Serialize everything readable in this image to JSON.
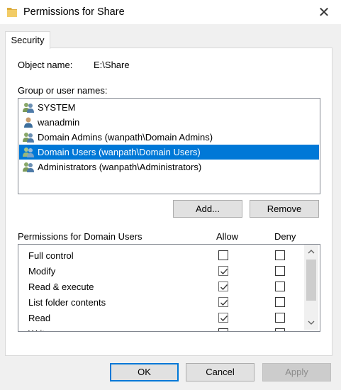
{
  "window": {
    "title": "Permissions for Share",
    "close_glyph": "✕"
  },
  "tabs": [
    {
      "label": "Security",
      "active": true
    }
  ],
  "object": {
    "label": "Object name:",
    "value": "E:\\Share"
  },
  "groups": {
    "label": "Group or user names:",
    "items": [
      {
        "name": "SYSTEM",
        "icon": "group-icon",
        "selected": false
      },
      {
        "name": "wanadmin",
        "icon": "user-icon",
        "selected": false
      },
      {
        "name": "Domain Admins (wanpath\\Domain Admins)",
        "icon": "group-icon",
        "selected": false
      },
      {
        "name": "Domain Users (wanpath\\Domain Users)",
        "icon": "group-icon",
        "selected": true
      },
      {
        "name": "Administrators (wanpath\\Administrators)",
        "icon": "group-icon",
        "selected": false
      }
    ]
  },
  "buttons": {
    "add": "Add...",
    "remove": "Remove",
    "ok": "OK",
    "cancel": "Cancel",
    "apply": "Apply"
  },
  "permissions": {
    "label": "Permissions for Domain Users",
    "allow_header": "Allow",
    "deny_header": "Deny",
    "rows": [
      {
        "name": "Full control",
        "allow": false,
        "deny": false
      },
      {
        "name": "Modify",
        "allow": true,
        "deny": false
      },
      {
        "name": "Read & execute",
        "allow": true,
        "deny": false
      },
      {
        "name": "List folder contents",
        "allow": true,
        "deny": false
      },
      {
        "name": "Read",
        "allow": true,
        "deny": false
      },
      {
        "name": "Write",
        "allow": false,
        "deny": false
      }
    ]
  },
  "colors": {
    "selection": "#0078d7",
    "folder": "#e8b84a"
  }
}
